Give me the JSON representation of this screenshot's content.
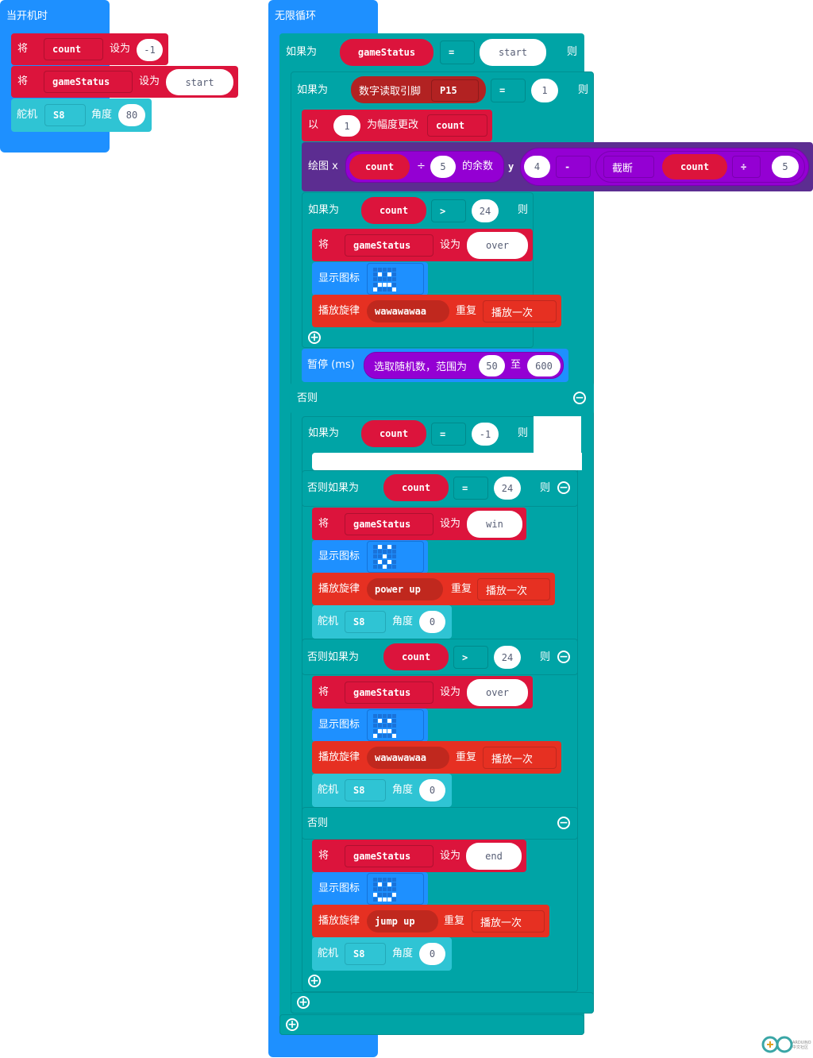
{
  "on_start": {
    "hat_label": "当开机时",
    "set_count": {
      "keyword": "将",
      "variable": "count",
      "set_label": "设为",
      "value": "-1"
    },
    "set_status": {
      "keyword": "将",
      "variable": "gameStatus",
      "set_label": "设为",
      "value": "start"
    },
    "servo": {
      "label": "舵机",
      "pin": "S8",
      "angle_label": "角度",
      "angle": "80"
    }
  },
  "forever": {
    "hat_label": "无限循环",
    "if1": {
      "label": "如果为",
      "variable": "gameStatus",
      "op": "=",
      "value": "start",
      "then": "则"
    },
    "if2": {
      "label": "如果为",
      "read_label": "数字读取引脚",
      "pin": "P15",
      "op": "=",
      "value": "1",
      "then": "则"
    },
    "change": {
      "label": "以",
      "amount": "1",
      "mid": "为幅度更改",
      "variable": "count"
    },
    "plot": {
      "label": "绘图 x",
      "var": "count",
      "div": "÷",
      "div_val": "5",
      "rem": "的余数",
      "y": "y",
      "y_val": "4",
      "minus": "-",
      "trunc": "截断",
      "var2": "count",
      "div2": "÷",
      "div_val2": "5"
    },
    "if3": {
      "label": "如果为",
      "variable": "count",
      "op": ">",
      "value": "24",
      "then": "则"
    },
    "set_over": {
      "keyword": "将",
      "variable": "gameStatus",
      "set_label": "设为",
      "value": "over"
    },
    "show_icon_1": {
      "label": "显示图标",
      "icon": "sad-icon",
      "leds": [
        0,
        0,
        0,
        0,
        0,
        0,
        1,
        0,
        1,
        0,
        0,
        0,
        0,
        0,
        0,
        0,
        1,
        1,
        1,
        0,
        1,
        0,
        0,
        0,
        1
      ]
    },
    "melody_1": {
      "label": "播放旋律",
      "melody": "wawawawaa",
      "repeat_label": "重复",
      "repeat": "播放一次"
    },
    "pause": {
      "label": "暂停 (ms)",
      "random_label": "选取随机数，范围为",
      "from": "50",
      "to_label": "至",
      "to": "600"
    },
    "else_label": "否则",
    "if4": {
      "label": "如果为",
      "variable": "count",
      "op": "=",
      "value": "-1",
      "then": "则"
    },
    "elseif1": {
      "label": "否则如果为",
      "variable": "count",
      "op": "=",
      "value": "24",
      "then": "则"
    },
    "set_win": {
      "keyword": "将",
      "variable": "gameStatus",
      "set_label": "设为",
      "value": "win"
    },
    "show_icon_2": {
      "label": "显示图标",
      "icon": "yes-icon",
      "leds": [
        0,
        1,
        0,
        1,
        0,
        0,
        0,
        0,
        0,
        0,
        0,
        0,
        1,
        0,
        0,
        0,
        1,
        0,
        1,
        0,
        0,
        0,
        1,
        0,
        0
      ]
    },
    "melody_2": {
      "label": "播放旋律",
      "melody": "power up",
      "repeat_label": "重复",
      "repeat": "播放一次"
    },
    "servo_2": {
      "label": "舵机",
      "pin": "S8",
      "angle_label": "角度",
      "angle": "0"
    },
    "elseif2": {
      "label": "否则如果为",
      "variable": "count",
      "op": ">",
      "value": "24",
      "then": "则"
    },
    "set_over2": {
      "keyword": "将",
      "variable": "gameStatus",
      "set_label": "设为",
      "value": "over"
    },
    "show_icon_3": {
      "label": "显示图标",
      "icon": "sad-icon",
      "leds": [
        0,
        0,
        0,
        0,
        0,
        0,
        1,
        0,
        1,
        0,
        0,
        0,
        0,
        0,
        0,
        0,
        1,
        1,
        1,
        0,
        1,
        0,
        0,
        0,
        1
      ]
    },
    "melody_3": {
      "label": "播放旋律",
      "melody": "wawawawaa",
      "repeat_label": "重复",
      "repeat": "播放一次"
    },
    "servo_3": {
      "label": "舵机",
      "pin": "S8",
      "angle_label": "角度",
      "angle": "0"
    },
    "else2_label": "否则",
    "set_end": {
      "keyword": "将",
      "variable": "gameStatus",
      "set_label": "设为",
      "value": "end"
    },
    "show_icon_4": {
      "label": "显示图标",
      "icon": "happy-icon",
      "leds": [
        0,
        0,
        0,
        0,
        0,
        0,
        1,
        0,
        1,
        0,
        0,
        0,
        0,
        0,
        0,
        1,
        0,
        0,
        0,
        1,
        0,
        1,
        1,
        1,
        0
      ]
    },
    "melody_4": {
      "label": "播放旋律",
      "melody": "jump up",
      "repeat_label": "重复",
      "repeat": "播放一次"
    },
    "servo_4": {
      "label": "舵机",
      "pin": "S8",
      "angle_label": "角度",
      "angle": "0"
    }
  },
  "logo": {
    "text": "ARDUINO 中文社区"
  }
}
